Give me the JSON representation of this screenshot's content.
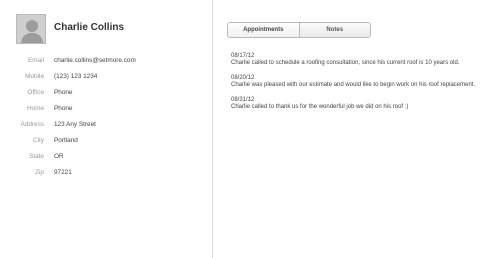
{
  "contact": {
    "name": "Charlie Collins",
    "avatar_icon": "user-silhouette-icon",
    "fields": [
      {
        "label": "Email",
        "value": "charlie.collins@setmore.com"
      },
      {
        "label": "Mobile",
        "value": "(123) 123 1234"
      },
      {
        "label": "Office",
        "value": "Phone"
      },
      {
        "label": "Home",
        "value": "Phone"
      },
      {
        "label": "Address",
        "value": "123 Any Street"
      },
      {
        "label": "City",
        "value": "Portland"
      },
      {
        "label": "State",
        "value": "OR"
      },
      {
        "label": "Zip",
        "value": "97221"
      }
    ]
  },
  "tabs": [
    {
      "label": "Appointments"
    },
    {
      "label": "Notes"
    }
  ],
  "notes": [
    {
      "date": "08/17/12",
      "text": "Charlie called to schedule a roofing consultation, since his current roof is 10 years old."
    },
    {
      "date": "08/20/12",
      "text": "Charlie was pleased with our estimate and would like to begin work on his roof replacement."
    },
    {
      "date": "08/31/12",
      "text": "Charlie called to thank us for the wonderful job we did on his roof :)"
    }
  ]
}
